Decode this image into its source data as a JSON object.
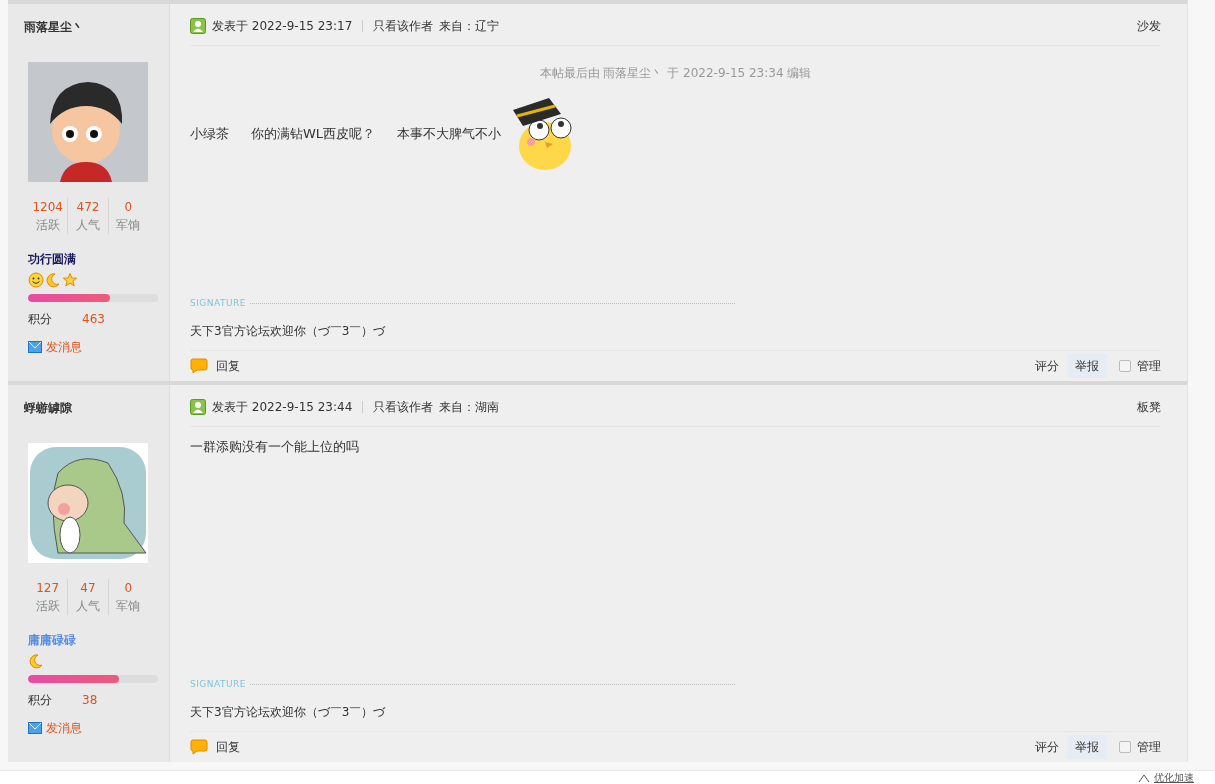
{
  "posts": [
    {
      "author": {
        "name": "雨落星尘丶",
        "avatar": {
          "kind": "boy"
        },
        "stats": [
          {
            "value": "1204",
            "label": "活跃"
          },
          {
            "value": "472",
            "label": "人气"
          },
          {
            "value": "0",
            "label": "军饷"
          }
        ],
        "rank": {
          "title": "功行圆满",
          "color": "#1a1a5e"
        },
        "medals": [
          {
            "kind": "sun"
          },
          {
            "kind": "moon"
          },
          {
            "kind": "star"
          }
        ],
        "progress": {
          "level": 0.63
        },
        "points_label": "积分",
        "points": "463",
        "message_link": "发消息"
      },
      "meta": {
        "posted": "发表于 2022-9-15 23:17",
        "author_only": "只看该作者",
        "from": "来自：辽宁",
        "floor": "沙发"
      },
      "edit_note": "本帖最后由 雨落星尘丶 于 2022-9-15 23:34 编辑",
      "content": [
        {
          "kind": "text",
          "text": "小绿茶"
        },
        {
          "kind": "text",
          "text": "你的满钻WL西皮呢？"
        },
        {
          "kind": "text",
          "text": "本事不大脾气不小"
        },
        {
          "kind": "sticker"
        }
      ],
      "signature_label": "SIGNATURE",
      "signature": "天下3官方论坛欢迎你（づ￣3￣）づ",
      "reply": "回复",
      "actions": [
        "评分",
        "举报"
      ],
      "manage": {
        "label": "管理",
        "checked": false
      }
    },
    {
      "author": {
        "name": "蜉蝣罅隙",
        "avatar": {
          "kind": "dino"
        },
        "stats": [
          {
            "value": "127",
            "label": "活跃"
          },
          {
            "value": "47",
            "label": "人气"
          },
          {
            "value": "0",
            "label": "军饷"
          }
        ],
        "rank": {
          "title": "庸庸碌碌",
          "color": "#5b8de0"
        },
        "medals": [
          {
            "kind": "moon"
          }
        ],
        "progress": {
          "level": 0.7
        },
        "points_label": "积分",
        "points": "38",
        "message_link": "发消息"
      },
      "meta": {
        "posted": "发表于 2022-9-15 23:44",
        "author_only": "只看该作者",
        "from": "来自：湖南",
        "floor": "板凳"
      },
      "content": [
        {
          "kind": "text",
          "text": "一群添购没有一个能上位的吗"
        }
      ],
      "signature_label": "SIGNATURE",
      "signature": "天下3官方论坛欢迎你（づ￣3￣）づ",
      "reply": "回复",
      "actions": [
        "评分",
        "举报"
      ],
      "manage": {
        "label": "管理",
        "checked": false
      }
    }
  ],
  "footer_tool": "优化加速"
}
